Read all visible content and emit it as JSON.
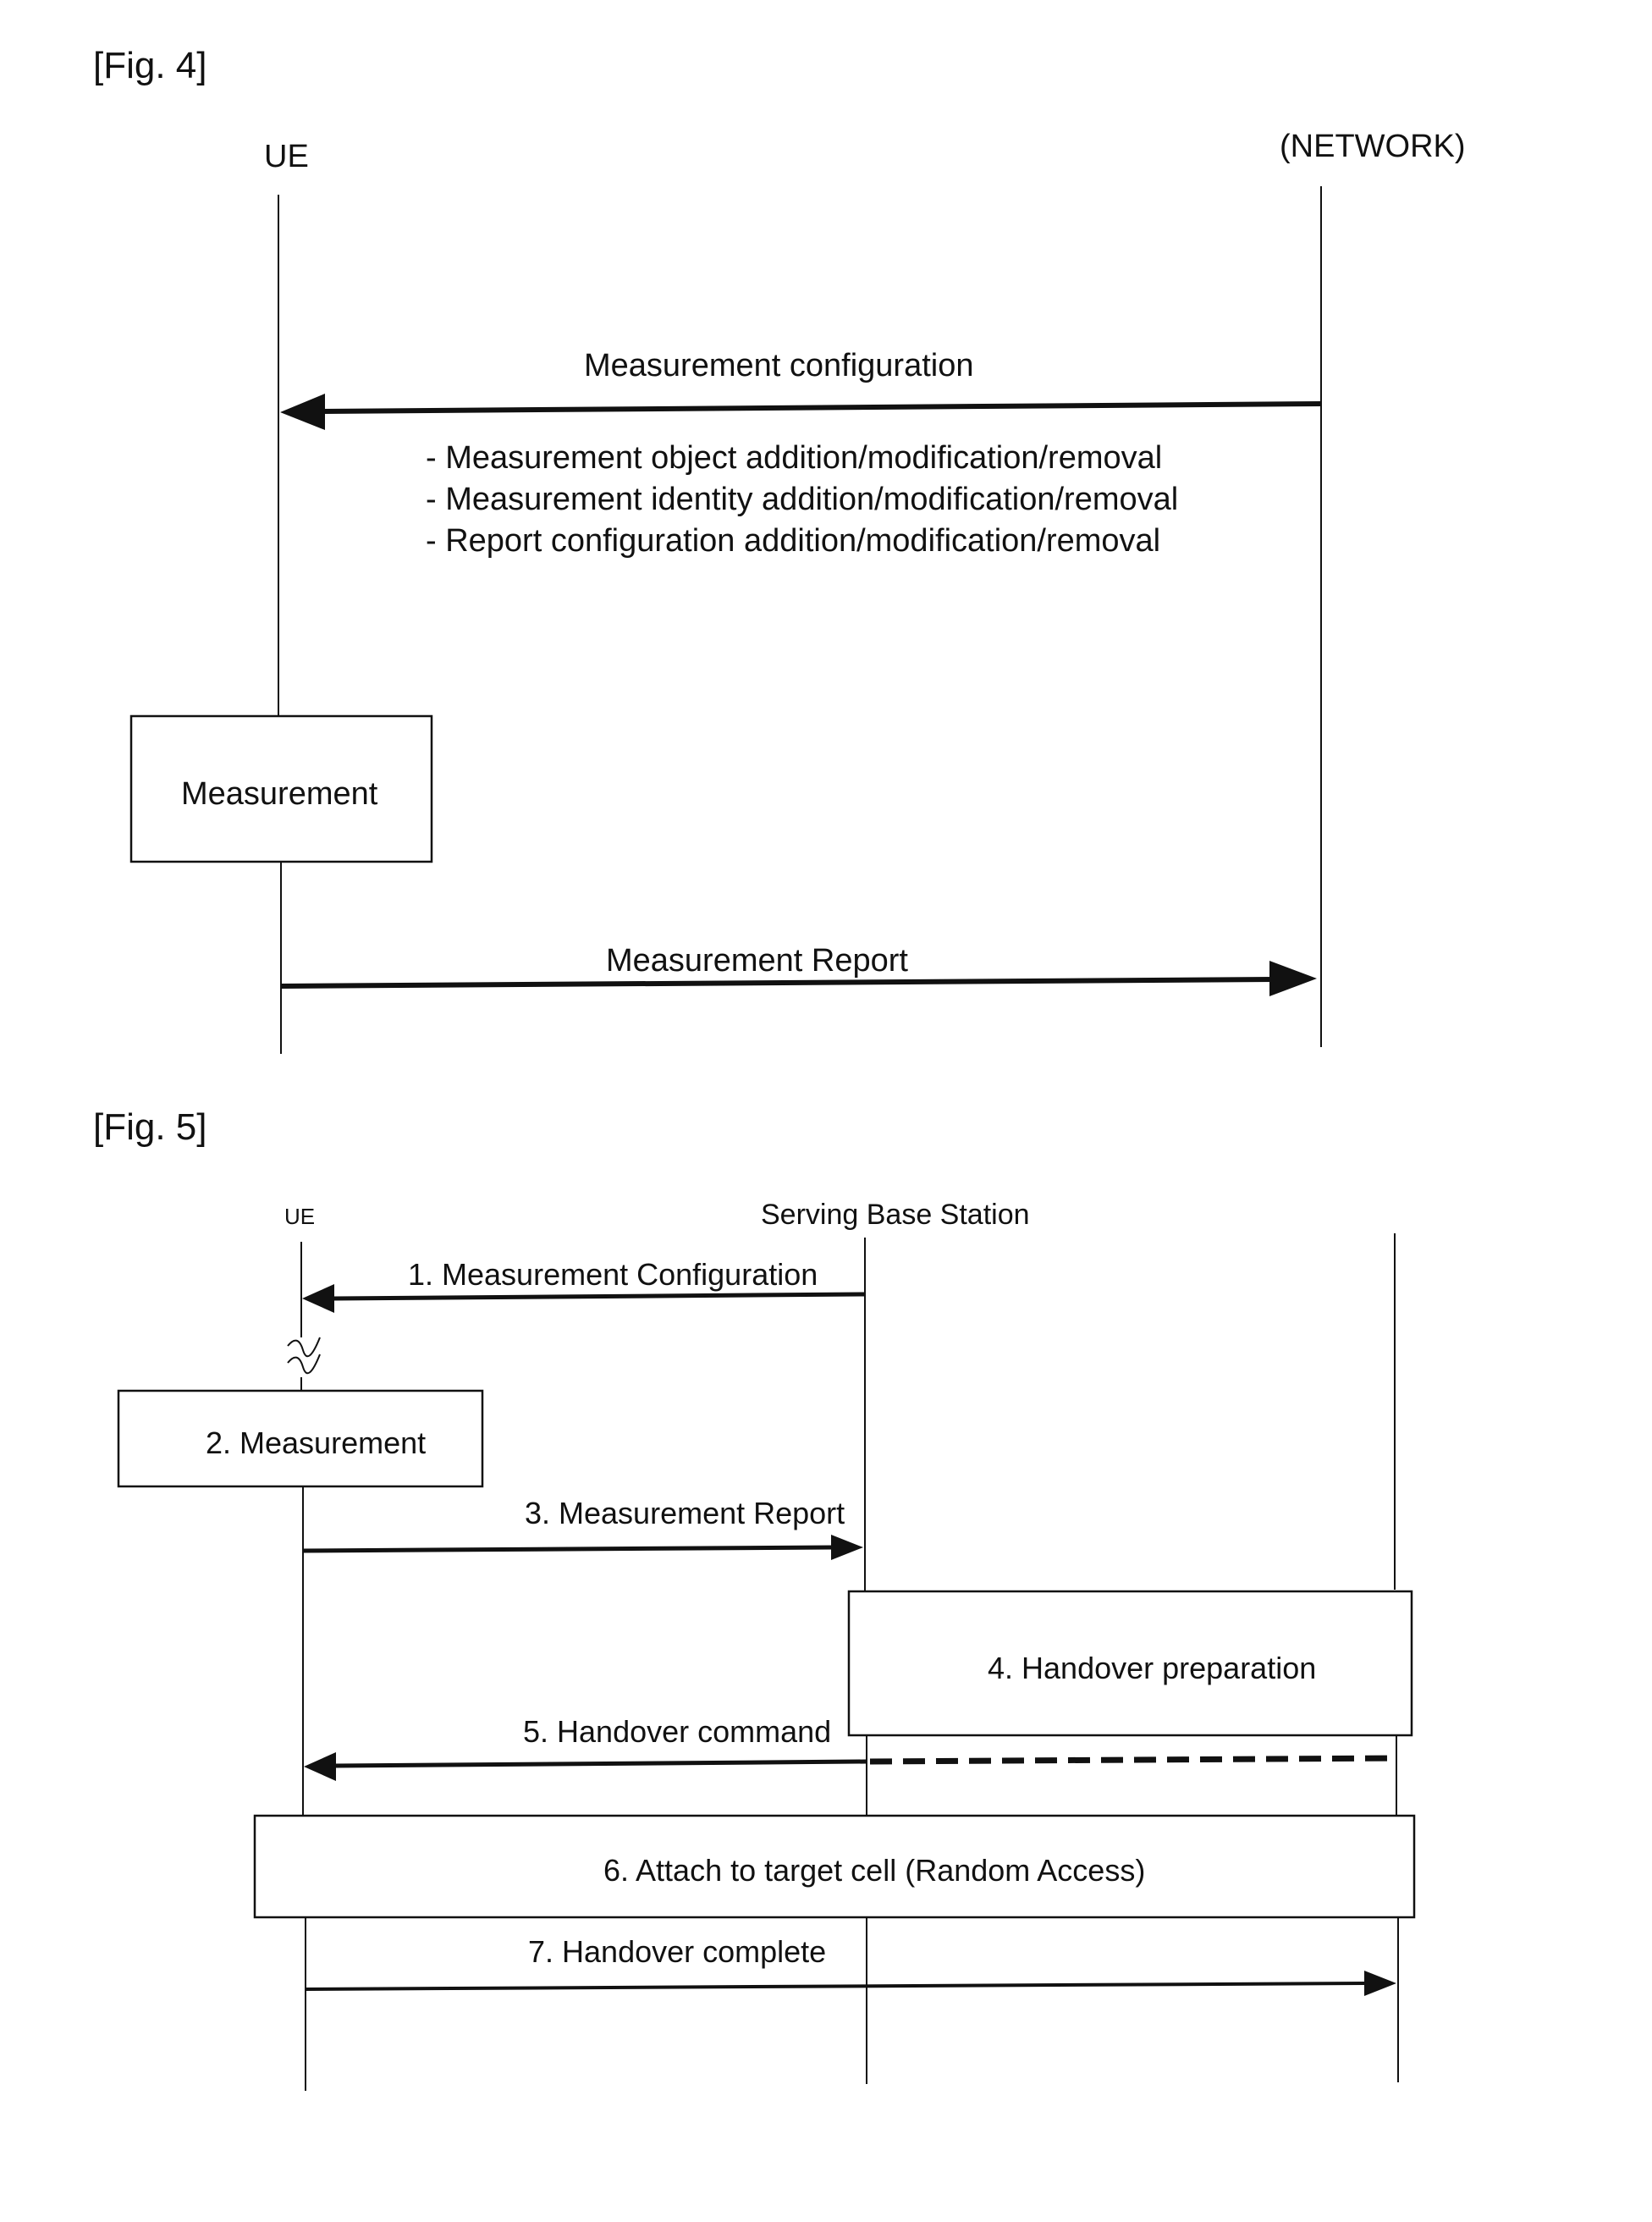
{
  "fig4": {
    "label": "[Fig. 4]",
    "actors": {
      "ue": "UE",
      "network": "(NETWORK)"
    },
    "messages": {
      "config": "Measurement configuration",
      "report": "Measurement Report"
    },
    "bullets": [
      "- Measurement object addition/modification/removal",
      "- Measurement identity addition/modification/removal",
      "- Report configuration addition/modification/removal"
    ],
    "box": "Measurement"
  },
  "fig5": {
    "label": "[Fig. 5]",
    "actors": {
      "ue": "UE",
      "serving": "Serving Base Station"
    },
    "steps": {
      "s1": "1. Measurement Configuration",
      "s2": "2. Measurement",
      "s3": "3. Measurement Report",
      "s4": "4.  Handover preparation",
      "s5": "5. Handover command",
      "s6": "6. Attach to target cell   (Random Access)",
      "s7": "7. Handover complete"
    }
  }
}
